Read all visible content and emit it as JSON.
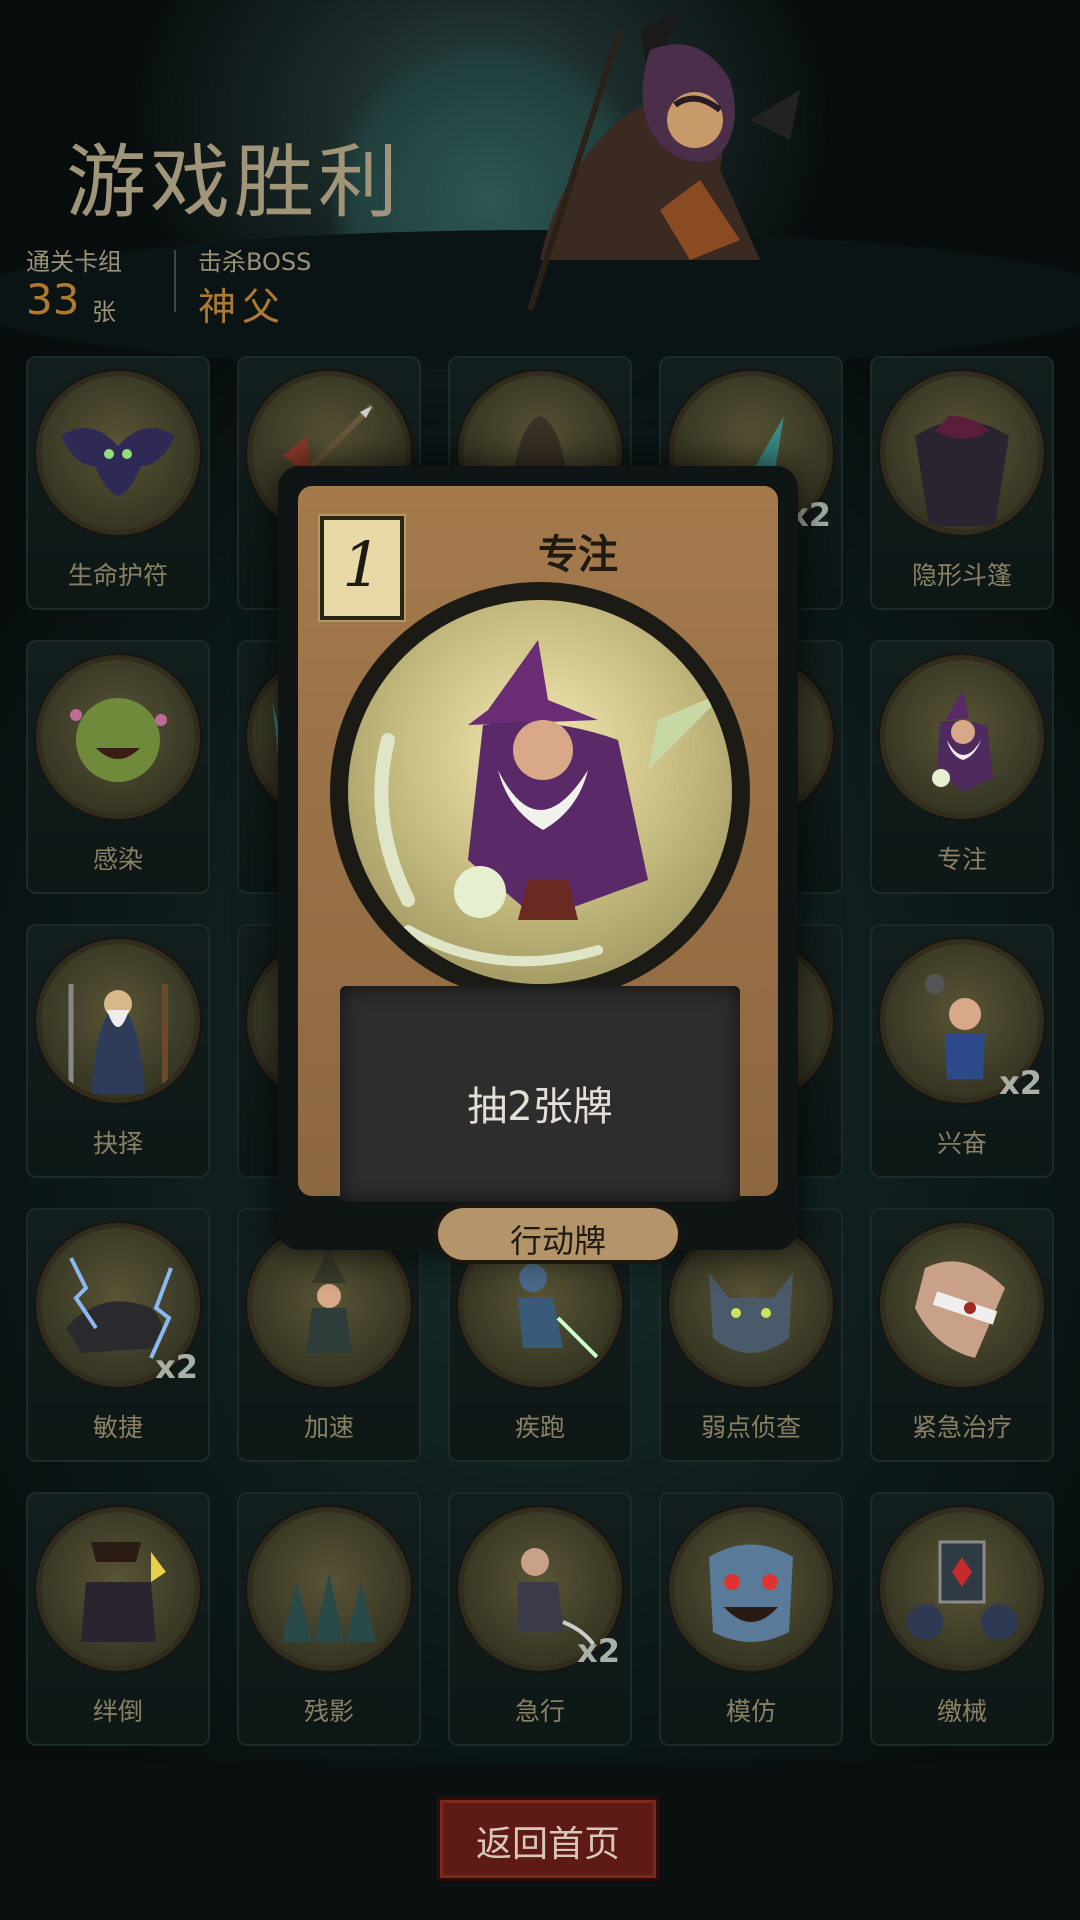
{
  "header": {
    "title": "游戏胜利",
    "deck_label": "通关卡组",
    "deck_count": "33",
    "deck_unit": "张",
    "boss_label": "击杀BOSS",
    "boss_name": "神父"
  },
  "cards": [
    {
      "name": "生命护符",
      "count": "",
      "icon": "bat-icon"
    },
    {
      "name": "",
      "count": "",
      "icon": "axe-arrow-icon"
    },
    {
      "name": "",
      "count": "",
      "icon": "hooded-figure-icon"
    },
    {
      "name": "",
      "count": "x2",
      "icon": "dagger-icon"
    },
    {
      "name": "隐形斗篷",
      "count": "",
      "icon": "cloak-icon"
    },
    {
      "name": "感染",
      "count": "",
      "icon": "goblin-icon"
    },
    {
      "name": "",
      "count": "",
      "icon": "blade-icon"
    },
    {
      "name": "",
      "count": "",
      "icon": "blank-icon"
    },
    {
      "name": "",
      "count": "",
      "icon": "blade-icon"
    },
    {
      "name": "专注",
      "count": "",
      "icon": "wizard-icon"
    },
    {
      "name": "抉择",
      "count": "",
      "icon": "sage-icon"
    },
    {
      "name": "",
      "count": "",
      "icon": "blank-icon"
    },
    {
      "name": "",
      "count": "",
      "icon": "blank-icon"
    },
    {
      "name": "",
      "count": "",
      "icon": "blank-icon"
    },
    {
      "name": "兴奋",
      "count": "x2",
      "icon": "dwarf-icon"
    },
    {
      "name": "敏捷",
      "count": "x2",
      "icon": "panther-icon"
    },
    {
      "name": "加速",
      "count": "",
      "icon": "witch-icon"
    },
    {
      "name": "疾跑",
      "count": "",
      "icon": "runner-icon"
    },
    {
      "name": "弱点侦查",
      "count": "",
      "icon": "wolf-icon"
    },
    {
      "name": "紧急治疗",
      "count": "",
      "icon": "bandage-icon"
    },
    {
      "name": "绊倒",
      "count": "",
      "icon": "tripped-icon"
    },
    {
      "name": "残影",
      "count": "",
      "icon": "shadow-clones-icon"
    },
    {
      "name": "急行",
      "count": "x2",
      "icon": "dash-icon"
    },
    {
      "name": "模仿",
      "count": "",
      "icon": "mimic-face-icon"
    },
    {
      "name": "缴械",
      "count": "",
      "icon": "shield-card-icon"
    }
  ],
  "popup": {
    "cost": "1",
    "title": "专注",
    "description": "抽2张牌",
    "type": "行动牌",
    "art_icon": "wizard-icon"
  },
  "footer": {
    "home_button": "返回首页"
  }
}
